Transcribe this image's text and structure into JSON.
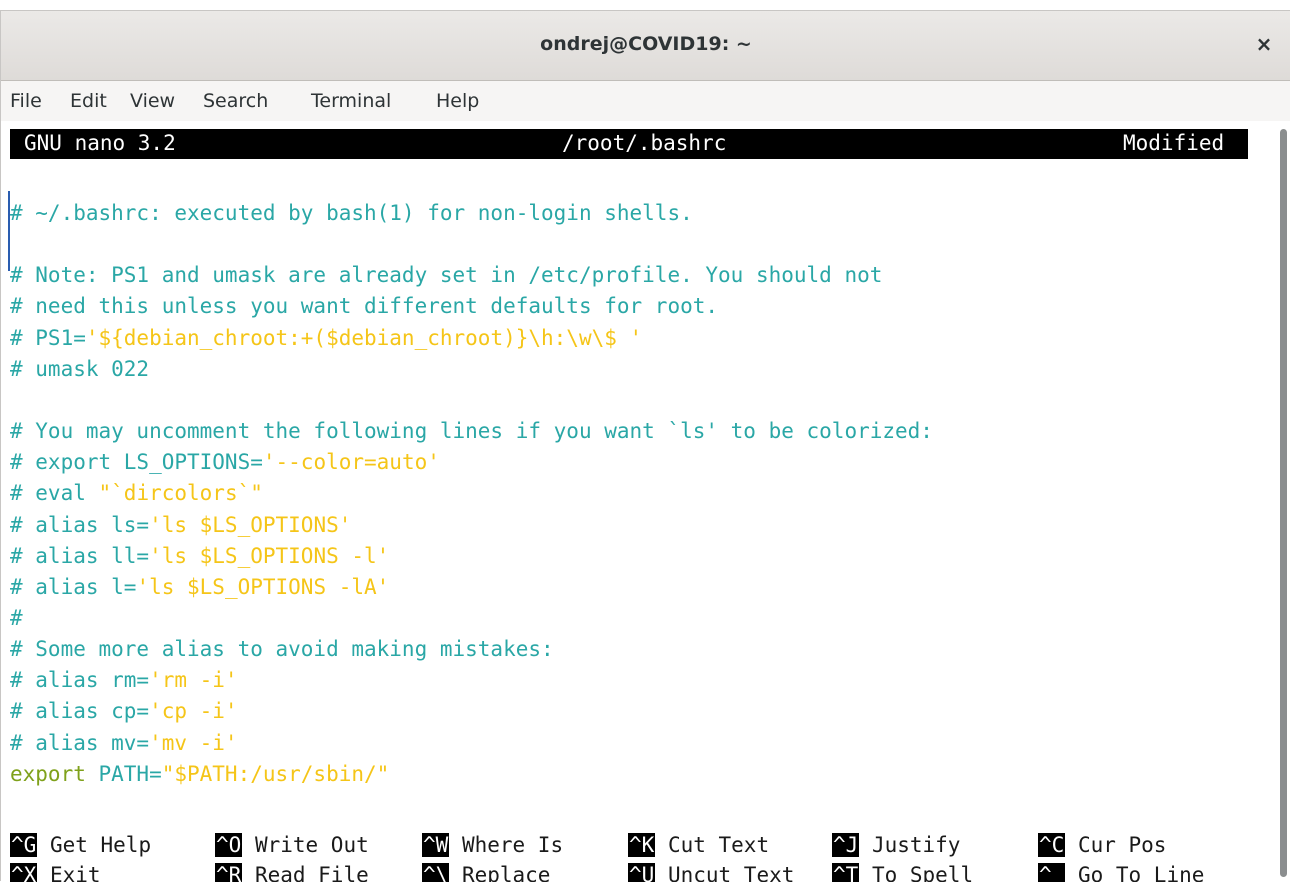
{
  "window": {
    "title": "ondrej@COVID19: ~",
    "close_glyph": "×"
  },
  "menu": [
    "File",
    "Edit",
    "View",
    "Search",
    "Terminal",
    "Help"
  ],
  "nano": {
    "version": "GNU nano 3.2",
    "filename": "/root/.bashrc",
    "status": "Modified"
  },
  "file_lines": [
    {
      "segments": [
        {
          "t": "# ~/.bashrc: executed by bash(1) for non-login shells.",
          "c": "cmt"
        }
      ]
    },
    {
      "segments": []
    },
    {
      "segments": [
        {
          "t": "# Note: PS1 and umask are already set in /etc/profile. You should not",
          "c": "cmt"
        }
      ]
    },
    {
      "segments": [
        {
          "t": "# need this unless you want different defaults for root.",
          "c": "cmt"
        }
      ]
    },
    {
      "segments": [
        {
          "t": "# PS1=",
          "c": "cmt"
        },
        {
          "t": "'${debian_chroot:+($debian_chroot)}\\h:\\w\\$ '",
          "c": "str"
        }
      ]
    },
    {
      "segments": [
        {
          "t": "# umask 022",
          "c": "cmt"
        }
      ]
    },
    {
      "segments": []
    },
    {
      "segments": [
        {
          "t": "# You may uncomment the following lines if you want `ls' to be colorized:",
          "c": "cmt"
        }
      ]
    },
    {
      "segments": [
        {
          "t": "# export LS_OPTIONS=",
          "c": "cmt"
        },
        {
          "t": "'--color=auto'",
          "c": "str"
        }
      ]
    },
    {
      "segments": [
        {
          "t": "# eval ",
          "c": "cmt"
        },
        {
          "t": "\"`dircolors`\"",
          "c": "str"
        }
      ]
    },
    {
      "segments": [
        {
          "t": "# alias ls=",
          "c": "cmt"
        },
        {
          "t": "'ls $LS_OPTIONS'",
          "c": "str"
        }
      ]
    },
    {
      "segments": [
        {
          "t": "# alias ll=",
          "c": "cmt"
        },
        {
          "t": "'ls $LS_OPTIONS -l'",
          "c": "str"
        }
      ]
    },
    {
      "segments": [
        {
          "t": "# alias l=",
          "c": "cmt"
        },
        {
          "t": "'ls $LS_OPTIONS -lA'",
          "c": "str"
        }
      ]
    },
    {
      "segments": [
        {
          "t": "#",
          "c": "cmt"
        }
      ]
    },
    {
      "segments": [
        {
          "t": "# Some more alias to avoid making mistakes:",
          "c": "cmt"
        }
      ]
    },
    {
      "segments": [
        {
          "t": "# alias rm=",
          "c": "cmt"
        },
        {
          "t": "'rm -i'",
          "c": "str"
        }
      ]
    },
    {
      "segments": [
        {
          "t": "# alias cp=",
          "c": "cmt"
        },
        {
          "t": "'cp -i'",
          "c": "str"
        }
      ]
    },
    {
      "segments": [
        {
          "t": "# alias mv=",
          "c": "cmt"
        },
        {
          "t": "'mv -i'",
          "c": "str"
        }
      ]
    },
    {
      "segments": [
        {
          "t": "export",
          "c": "kw"
        },
        {
          "t": " PATH=",
          "c": "txt"
        },
        {
          "t": "\"$PATH:/usr/sbin/\"",
          "c": "str"
        }
      ]
    }
  ],
  "shortcuts": [
    [
      {
        "key": "^G",
        "label": " Get Help"
      },
      {
        "key": "^O",
        "label": " Write Out"
      },
      {
        "key": "^W",
        "label": " Where Is"
      },
      {
        "key": "^K",
        "label": " Cut Text"
      },
      {
        "key": "^J",
        "label": " Justify"
      },
      {
        "key": "^C",
        "label": " Cur Pos"
      }
    ],
    [
      {
        "key": "^X",
        "label": " Exit"
      },
      {
        "key": "^R",
        "label": " Read File"
      },
      {
        "key": "^\\",
        "label": " Replace"
      },
      {
        "key": "^U",
        "label": " Uncut Text"
      },
      {
        "key": "^T",
        "label": " To Spell"
      },
      {
        "key": "^_",
        "label": " Go To Line"
      }
    ]
  ]
}
